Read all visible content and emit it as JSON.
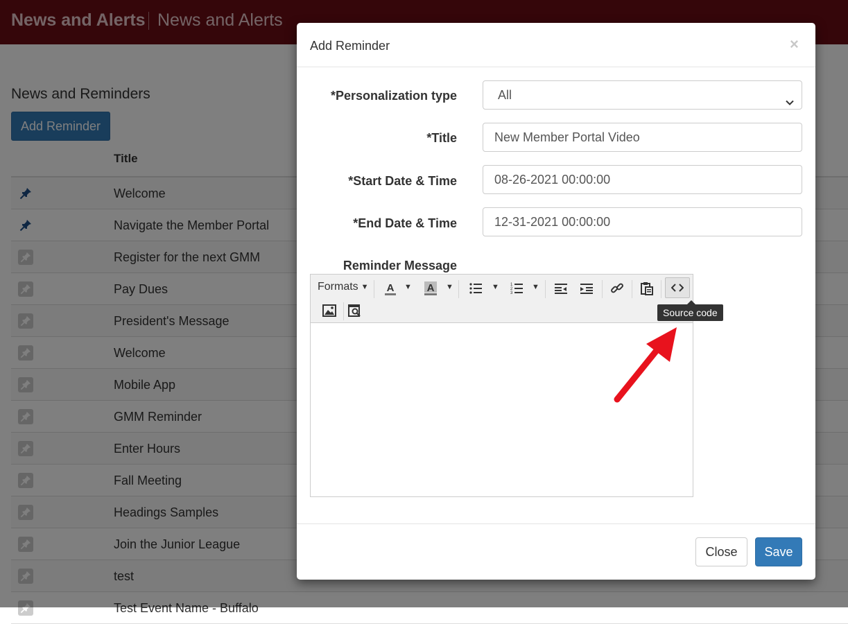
{
  "header": {
    "app_title": "News and Alerts",
    "page_title": "News and Alerts"
  },
  "page": {
    "section_title": "News and Reminders",
    "add_button": "Add Reminder",
    "column_title": "Title",
    "rows": [
      {
        "title": "Welcome",
        "pinned": true
      },
      {
        "title": "Navigate the Member Portal",
        "pinned": true
      },
      {
        "title": "Register for the next GMM",
        "pinned": false
      },
      {
        "title": "Pay Dues",
        "pinned": false
      },
      {
        "title": "President's Message",
        "pinned": false
      },
      {
        "title": "Welcome",
        "pinned": false
      },
      {
        "title": "Mobile App",
        "pinned": false
      },
      {
        "title": "GMM Reminder",
        "pinned": false
      },
      {
        "title": "Enter Hours",
        "pinned": false
      },
      {
        "title": "Fall Meeting",
        "pinned": false
      },
      {
        "title": "Headings Samples",
        "pinned": false
      },
      {
        "title": "Join the Junior League",
        "pinned": false
      },
      {
        "title": "test",
        "pinned": false
      },
      {
        "title": "Test Event Name - Buffalo",
        "pinned": false
      }
    ]
  },
  "modal": {
    "title": "Add Reminder",
    "close_glyph": "×",
    "fields": {
      "personalization_label": "*Personalization type",
      "personalization_value": "All",
      "title_label": "*Title",
      "title_value": "New Member Portal Video",
      "start_label": "*Start Date & Time",
      "start_value": "08-26-2021 00:00:00",
      "end_label": "*End Date & Time",
      "end_value": "12-31-2021 00:00:00",
      "message_label": "Reminder Message"
    },
    "editor": {
      "formats_label": "Formats",
      "tooltip": "Source code",
      "tools": [
        "text-color-icon",
        "background-color-icon",
        "bullet-list-icon",
        "numbered-list-icon",
        "outdent-icon",
        "indent-icon",
        "link-icon",
        "paste-icon",
        "source-code-icon",
        "image-icon",
        "preview-icon"
      ]
    },
    "footer": {
      "close_label": "Close",
      "save_label": "Save"
    }
  },
  "colors": {
    "header_bg": "#6b0d14",
    "primary": "#337ab7",
    "annotation_arrow": "#e8121d"
  }
}
